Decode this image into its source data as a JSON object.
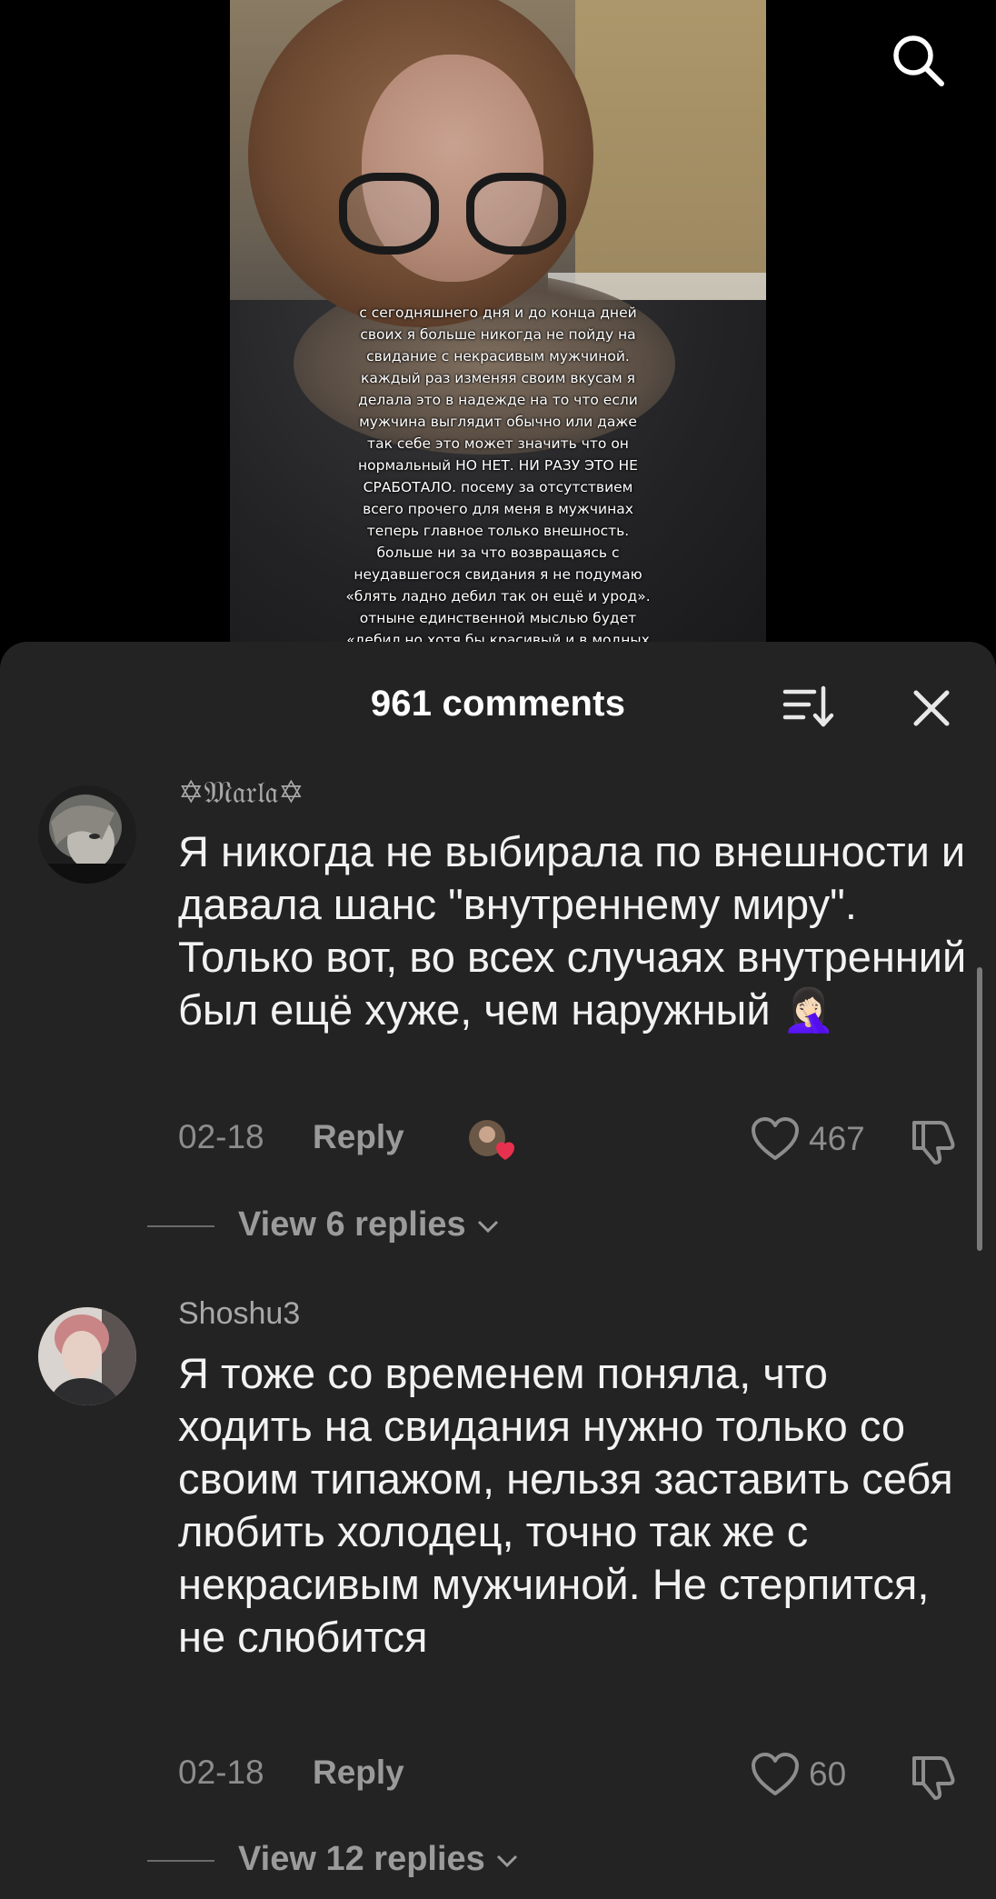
{
  "video": {
    "overlay_text": "с сегодняшнего дня и до конца дней\nсвоих я больше никогда не пойду на\nсвидание с некрасивым мужчиной.\nкаждый раз изменяя своим вкусам я\nделала это в надежде на то что если\nмужчина выглядит обычно или даже\nтак себе это может значить что он\nнормальный НО НЕТ. НИ РАЗУ ЭТО НЕ\nСРАБОТАЛО. посему за отсутствием\nвсего прочего для меня в мужчинах\nтеперь главное только внешность.\nбольше ни за что возвращаясь с\nнеудавшегося свидания я не подумаю\n«блять ладно дебил так он ещё и урод».\nотныне единственной мыслью будет\n«дебил но хотя бы красивый и в модных"
  },
  "icons": {
    "search": "search-icon",
    "sort": "sort-icon",
    "close": "close-icon",
    "like": "heart-icon",
    "dislike": "dislike-icon",
    "chevron": "chevron-down-icon"
  },
  "sheet": {
    "title": "961 comments"
  },
  "comments": [
    {
      "user": "✡𝔐𝔞𝔯𝔩𝔞✡",
      "text": "Я никогда не выбирала по внешности и давала шанс \"внутреннему миру\". Только вот, во всех случаях внутренний был ещё хуже, чем наружный 🤦🏻‍♀️",
      "date": "02-18",
      "reply_label": "Reply",
      "likes": "467",
      "view_replies": "View 6 replies"
    },
    {
      "user": "Shoshu3",
      "text": "Я тоже со временем поняла, что ходить на свидания нужно только со своим типажом, нельзя заставить себя любить холодец, точно так же с некрасивым мужчиной. Не стерпится, не слюбится",
      "date": "02-18",
      "reply_label": "Reply",
      "likes": "60",
      "view_replies": "View 12 replies"
    }
  ],
  "colors": {
    "sheet_bg": "#232323",
    "liked_heart": "#e8304f"
  }
}
